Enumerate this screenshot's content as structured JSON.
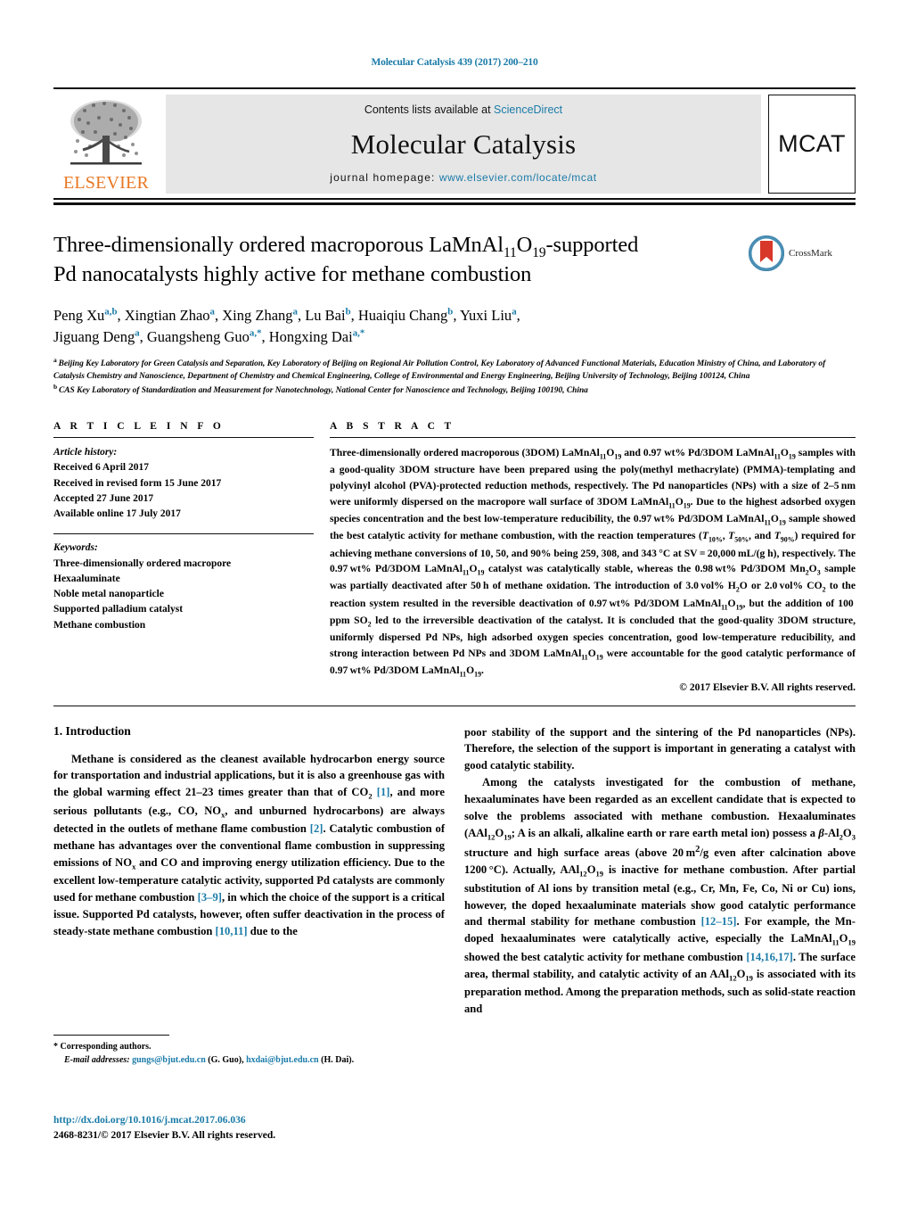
{
  "running_head": "Molecular Catalysis 439 (2017) 200–210",
  "masthead": {
    "publisher_name": "ELSEVIER",
    "contents_prefix": "Contents lists available at ",
    "contents_link": "ScienceDirect",
    "journal_title": "Molecular Catalysis",
    "homepage_prefix": "journal homepage: ",
    "homepage_url": "www.elsevier.com/locate/mcat",
    "journal_badge": "MCAT"
  },
  "crossmark": {
    "label": "CrossMark"
  },
  "title": {
    "line1_a": "Three-dimensionally ordered macroporous LaMnAl",
    "line1_sub1": "11",
    "line1_b": "O",
    "line1_sub2": "19",
    "line1_c": "-supported",
    "line2": "Pd nanocatalysts highly active for methane combustion"
  },
  "authors": [
    {
      "name": "Peng Xu",
      "sup": "a,b",
      "sep": ", "
    },
    {
      "name": "Xingtian Zhao",
      "sup": "a",
      "sep": ", "
    },
    {
      "name": "Xing Zhang",
      "sup": "a",
      "sep": ", "
    },
    {
      "name": "Lu Bai",
      "sup": "b",
      "sep": ", "
    },
    {
      "name": "Huaiqiu Chang",
      "sup": "b",
      "sep": ", "
    },
    {
      "name": "Yuxi Liu",
      "sup": "a",
      "sep": ","
    },
    {
      "name": "Jiguang Deng",
      "sup": "a",
      "sep": ", "
    },
    {
      "name": "Guangsheng Guo",
      "sup": "a,*",
      "sep": ", "
    },
    {
      "name": "Hongxing Dai",
      "sup": "a,*",
      "sep": ""
    }
  ],
  "affiliations": [
    {
      "marker": "a",
      "text": "Beijing Key Laboratory for Green Catalysis and Separation, Key Laboratory of Beijing on Regional Air Pollution Control, Key Laboratory of Advanced Functional Materials, Education Ministry of China, and Laboratory of Catalysis Chemistry and Nanoscience, Department of Chemistry and Chemical Engineering, College of Environmental and Energy Engineering, Beijing University of Technology, Beijing 100124, China"
    },
    {
      "marker": "b",
      "text": "CAS Key Laboratory of Standardization and Measurement for Nanotechnology, National Center for Nanoscience and Technology, Beijing 100190, China"
    }
  ],
  "article_info": {
    "heading": "A R T I C L E   I N F O",
    "history_label": "Article history:",
    "history": [
      "Received 6 April 2017",
      "Received in revised form 15 June 2017",
      "Accepted 27 June 2017",
      "Available online 17 July 2017"
    ],
    "keywords_label": "Keywords:",
    "keywords": [
      "Three-dimensionally ordered macropore",
      "Hexaaluminate",
      "Noble metal nanoparticle",
      "Supported palladium catalyst",
      "Methane combustion"
    ]
  },
  "abstract": {
    "heading": "A B S T R A C T",
    "copyright": "© 2017 Elsevier B.V. All rights reserved."
  },
  "introduction": {
    "number_title": "1.  Introduction"
  },
  "footnote": {
    "star_line": "*  Corresponding authors.",
    "email_label": "E-mail addresses:",
    "email1": "gungs@bjut.edu.cn",
    "email1_name": "(G. Guo)",
    "email2": "hxdai@bjut.edu.cn",
    "email2_name": "(H. Dai)."
  },
  "doi": {
    "url": "http://dx.doi.org/10.1016/j.mcat.2017.06.036",
    "issn": "2468-8231/© 2017 Elsevier B.V. All rights reserved."
  },
  "colors": {
    "link": "#1a7ba8",
    "elsevier_orange": "#E87722",
    "masthead_bg": "#e6e6e6"
  }
}
